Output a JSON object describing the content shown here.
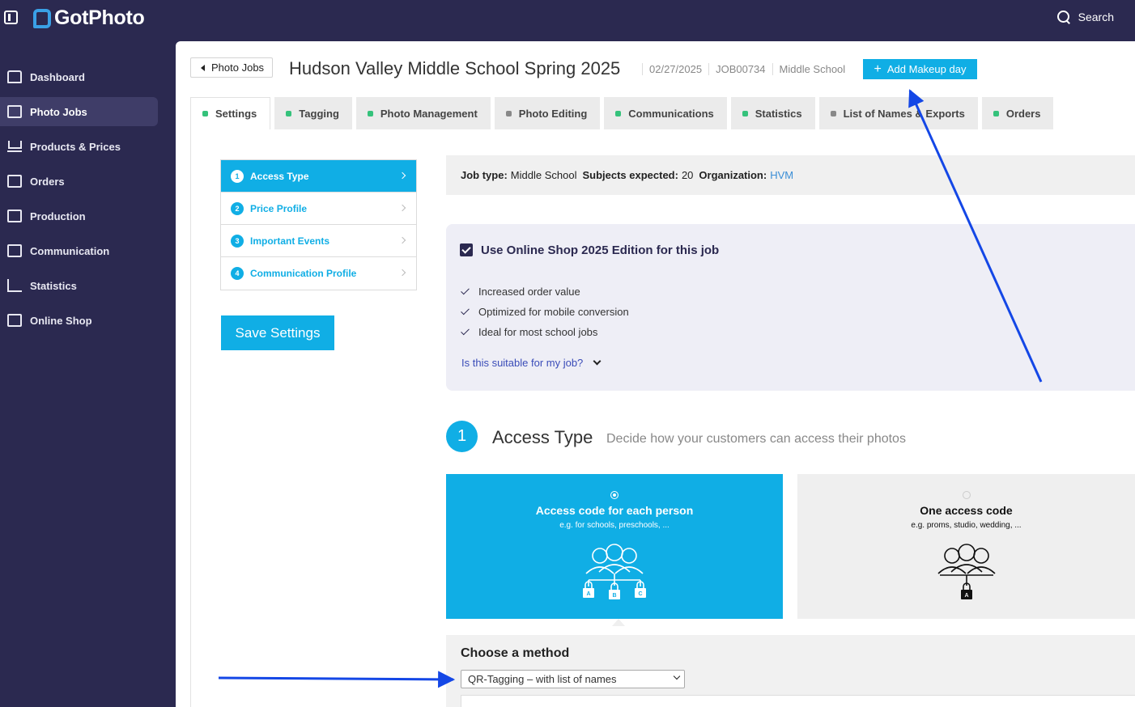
{
  "app": {
    "name": "GotPhoto"
  },
  "header": {
    "search_label": "Search"
  },
  "sidebar": {
    "items": [
      {
        "label": "Dashboard"
      },
      {
        "label": "Photo Jobs"
      },
      {
        "label": "Products & Prices"
      },
      {
        "label": "Orders"
      },
      {
        "label": "Production"
      },
      {
        "label": "Communication"
      },
      {
        "label": "Statistics"
      },
      {
        "label": "Online Shop"
      }
    ]
  },
  "job": {
    "back_label": "Photo Jobs",
    "title": "Hudson Valley Middle School Spring 2025",
    "date": "02/27/2025",
    "code": "JOB00734",
    "type": "Middle School",
    "add_makeup_label": "Add Makeup day"
  },
  "tabs": [
    {
      "label": "Settings",
      "status": "complete"
    },
    {
      "label": "Tagging",
      "status": "complete"
    },
    {
      "label": "Photo Management",
      "status": "complete"
    },
    {
      "label": "Photo Editing",
      "status": "incomplete"
    },
    {
      "label": "Communications",
      "status": "complete"
    },
    {
      "label": "Statistics",
      "status": "complete"
    },
    {
      "label": "List of Names & Exports",
      "status": "incomplete"
    },
    {
      "label": "Orders",
      "status": "complete"
    }
  ],
  "steps": [
    {
      "num": "1",
      "label": "Access Type"
    },
    {
      "num": "2",
      "label": "Price Profile"
    },
    {
      "num": "3",
      "label": "Important Events"
    },
    {
      "num": "4",
      "label": "Communication Profile"
    }
  ],
  "save_label": "Save Settings",
  "info": {
    "job_type_label": "Job type:",
    "job_type_value": "Middle School",
    "subjects_label": "Subjects expected:",
    "subjects_value": "20",
    "org_label": "Organization:",
    "org_value": "HVM"
  },
  "shop": {
    "checked": true,
    "title": "Use Online Shop 2025 Edition for this job",
    "benefits": [
      "Increased order value",
      "Optimized for mobile conversion",
      "Ideal for most school jobs"
    ],
    "suitable_link": "Is this suitable for my job?"
  },
  "access": {
    "number": "1",
    "title": "Access Type",
    "subtitle": "Decide how your customers can access their photos",
    "options": [
      {
        "title": "Access code for each person",
        "subtitle": "e.g. for schools, preschools, ...",
        "selected": true,
        "lock_labels": [
          "A",
          "B",
          "C"
        ]
      },
      {
        "title": "One access code",
        "subtitle": "e.g. proms, studio, wedding, ...",
        "selected": false,
        "lock_labels": [
          "A"
        ]
      }
    ]
  },
  "method": {
    "title": "Choose a method",
    "selected": "QR-Tagging – with list of names"
  },
  "colors": {
    "accent": "#10aee5",
    "sidebar": "#2b2950",
    "annotation": "#1447e6"
  }
}
